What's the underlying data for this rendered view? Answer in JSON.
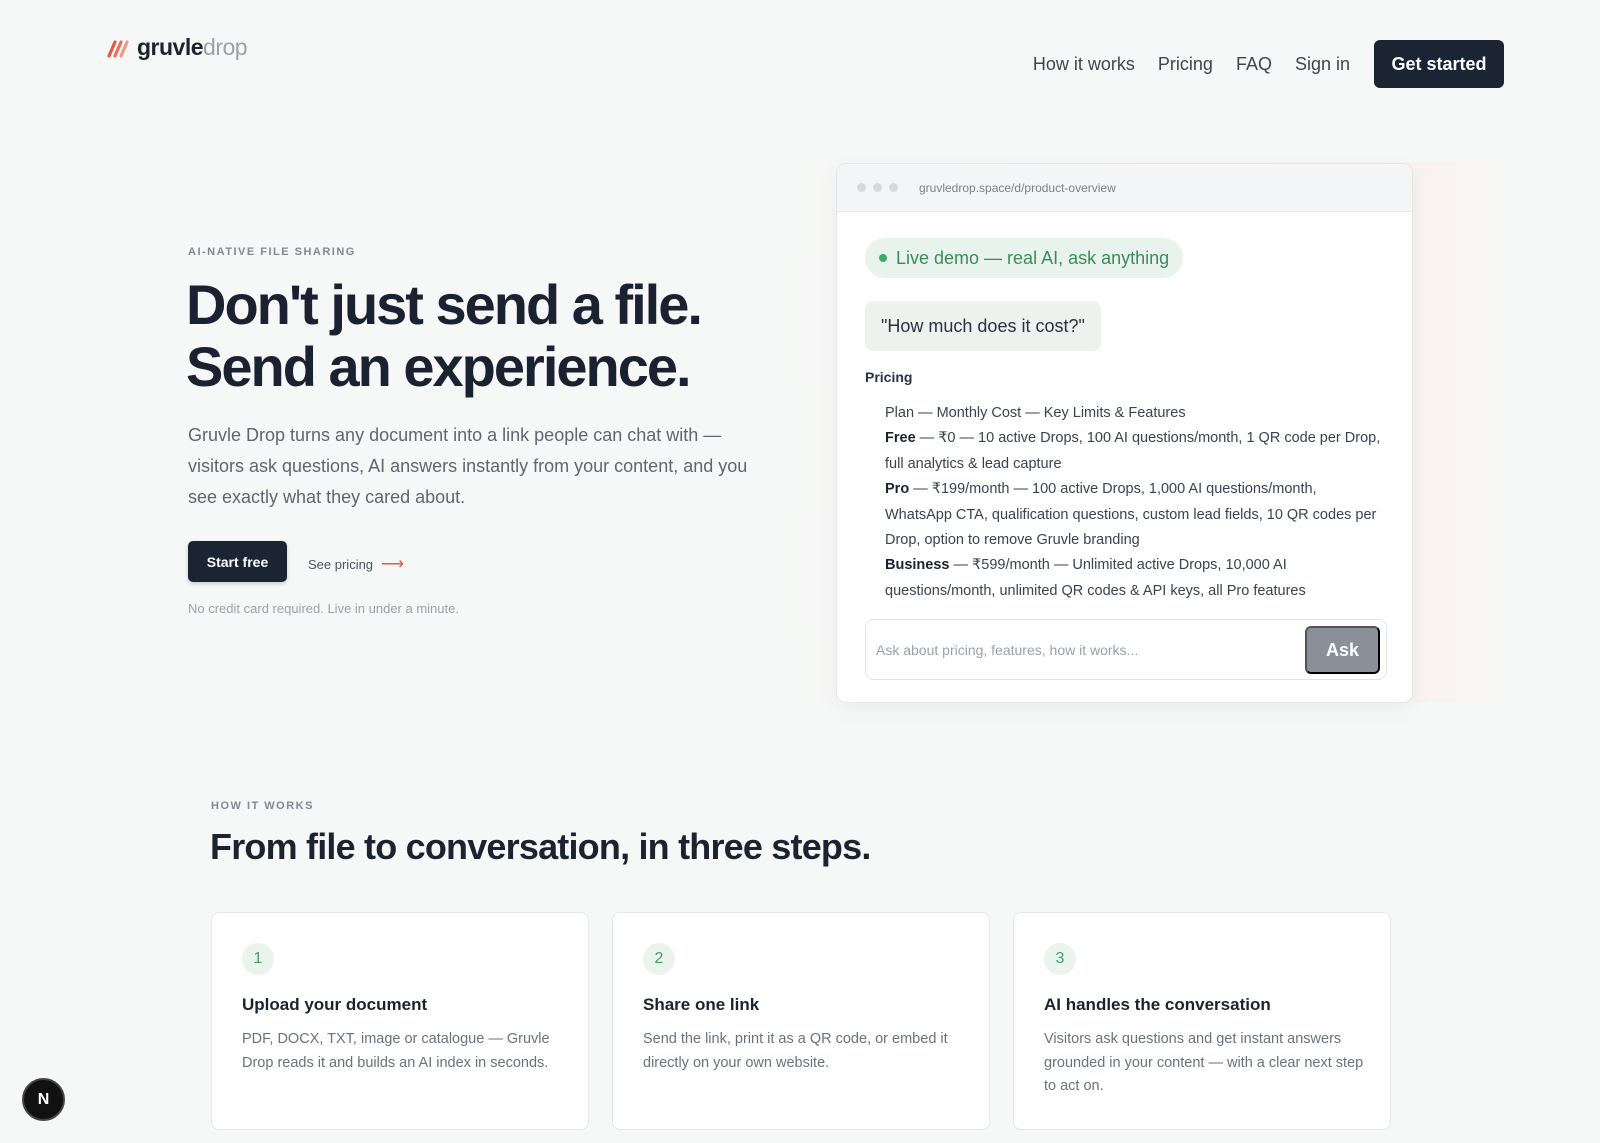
{
  "brand": {
    "name_bold": "gruvle",
    "name_light": "drop",
    "accent": "#e4584a"
  },
  "nav": {
    "links": [
      "How it works",
      "Pricing",
      "FAQ",
      "Sign in"
    ],
    "cta": "Get started"
  },
  "hero": {
    "eyebrow": "AI-NATIVE FILE SHARING",
    "title_line1": "Don't just send a file.",
    "title_line2": "Send an experience.",
    "description": "Gruvle Drop turns any document into a link people can chat with — visitors ask questions, AI answers instantly from your content, and you see exactly what they cared about.",
    "primary_cta": "Start free",
    "secondary_cta": "See pricing",
    "secondary_arrow": "⟶",
    "note": "No credit card required. Live in under a minute."
  },
  "demo": {
    "url": "gruvledrop.space/d/product-overview",
    "live_label": "Live demo — real AI, ask anything",
    "question": "\"How much does it cost?\"",
    "answer_title": "Pricing",
    "answer_header": "Plan — Monthly Cost — Key Limits & Features",
    "plans": [
      {
        "name": "Free",
        "text": " — ₹0 — 10 active Drops, 100 AI questions/month, 1 QR code per Drop, full analytics & lead capture"
      },
      {
        "name": "Pro",
        "text": " — ₹199/month — 100 active Drops, 1,000 AI questions/month, WhatsApp CTA, qualification questions, custom lead fields, 10 QR codes per Drop, option to remove Gruvle branding"
      },
      {
        "name": "Business",
        "text": " — ₹599/month — Unlimited active Drops, 10,000 AI questions/month, unlimited QR codes & API keys, all Pro features"
      }
    ],
    "ask_placeholder": "Ask about pricing, features, how it works...",
    "ask_button": "Ask"
  },
  "how_it_works": {
    "eyebrow": "HOW IT WORKS",
    "title": "From file to conversation, in three steps.",
    "steps": [
      {
        "num": "1",
        "title": "Upload your document",
        "desc": "PDF, DOCX, TXT, image or catalogue — Gruvle Drop reads it and builds an AI index in seconds."
      },
      {
        "num": "2",
        "title": "Share one link",
        "desc": "Send the link, print it as a QR code, or embed it directly on your own website."
      },
      {
        "num": "3",
        "title": "AI handles the conversation",
        "desc": "Visitors ask questions and get instant answers grounded in your content — with a clear next step to act on."
      }
    ]
  },
  "dev_badge": "N"
}
